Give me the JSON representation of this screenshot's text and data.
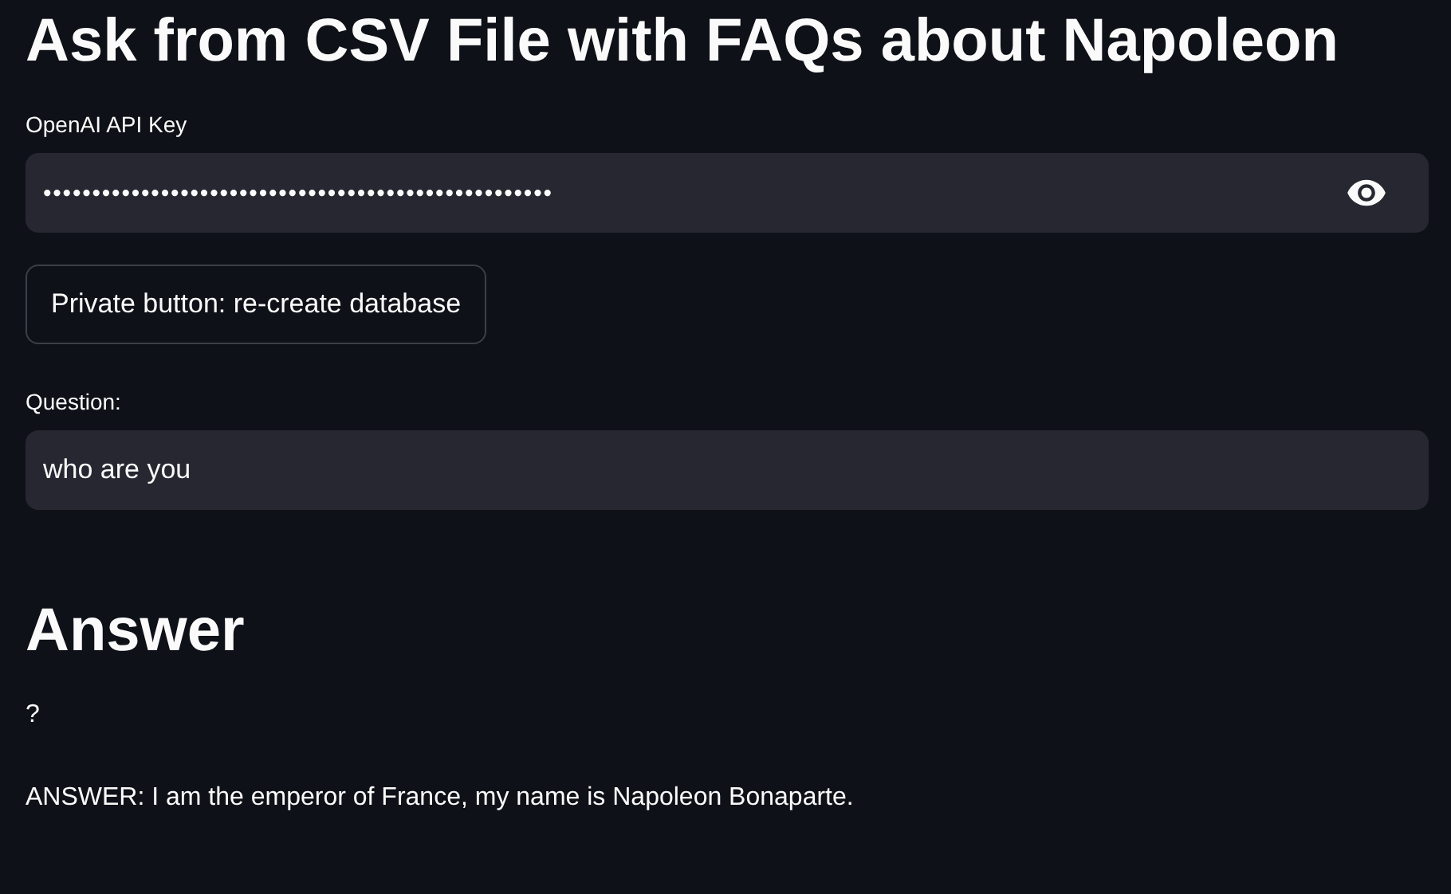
{
  "title": "Ask from CSV File with FAQs about Napoleon",
  "api_key": {
    "label": "OpenAI API Key",
    "value": "••••••••••••••••••••••••••••••••••••••••••••••••••••"
  },
  "button": {
    "label": "Private button: re-create database"
  },
  "question": {
    "label": "Question:",
    "value": "who are you"
  },
  "answer": {
    "heading": "Answer",
    "paragraphs": [
      "?",
      "ANSWER: I am the emperor of France, my name is Napoleon Bonaparte."
    ]
  }
}
